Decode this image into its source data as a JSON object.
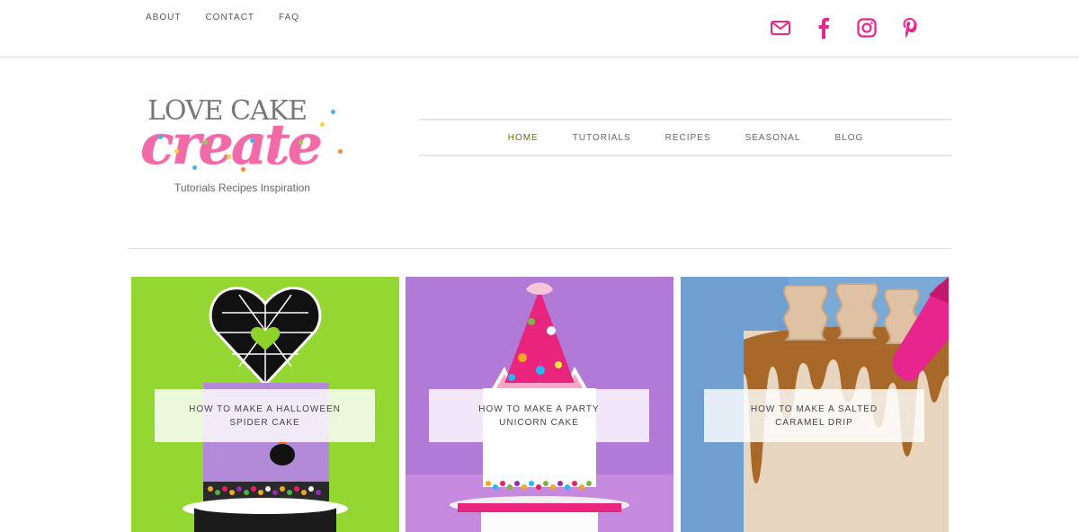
{
  "topnav": {
    "about": "ABOUT",
    "contact": "CONTACT",
    "faq": "FAQ"
  },
  "social": {
    "color": "#e8248f",
    "icons": [
      "email-icon",
      "facebook-icon",
      "instagram-icon",
      "pinterest-icon"
    ]
  },
  "logo": {
    "line1": "LOVE CAKE",
    "line2": "create",
    "tagline": "Tutorials Recipes Inspiration",
    "pink": "#f26aa8"
  },
  "mainnav": {
    "items": [
      "HOME",
      "TUTORIALS",
      "RECIPES",
      "SEASONAL",
      "BLOG"
    ],
    "active": "HOME"
  },
  "posts": [
    {
      "title": "HOW TO MAKE A HALLOWEEN SPIDER CAKE"
    },
    {
      "title": "HOW TO MAKE A PARTY UNICORN CAKE"
    },
    {
      "title": "HOW TO MAKE A SALTED CARAMEL DRIP"
    }
  ]
}
